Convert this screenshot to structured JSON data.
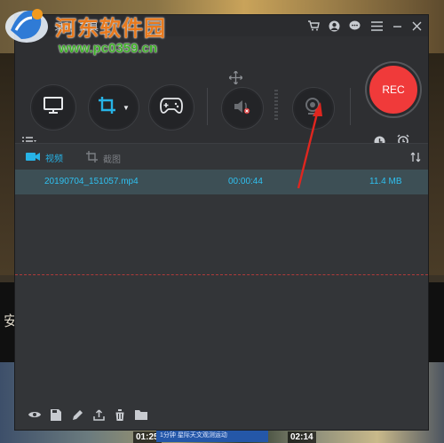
{
  "watermark": {
    "title": "河东软件园",
    "url": "www.pc0359.cn"
  },
  "background": {
    "side_text": "安布",
    "thumb_times": [
      "01:25",
      "02:14"
    ],
    "blue_caption": "1分钟 星际天文观测运动"
  },
  "titlebar": {
    "menus": [
      "录制",
      "工具"
    ],
    "icons": [
      "cart-icon",
      "user-icon",
      "chat-icon",
      "menu-icon",
      "minimize-icon",
      "close-icon"
    ]
  },
  "controls": {
    "buttons": [
      "monitor-icon",
      "crop-icon",
      "gamepad-icon",
      "speaker-icon",
      "webcam-icon"
    ],
    "rec_label": "REC"
  },
  "tabs": {
    "video_label": "视频",
    "screenshot_label": "截图"
  },
  "files": [
    {
      "name": "20190704_151057.mp4",
      "duration": "00:00:44",
      "size": "11.4 MB"
    }
  ],
  "colors": {
    "accent": "#27b3e6",
    "rec": "#f03a3a",
    "arrow": "#e0261f"
  }
}
